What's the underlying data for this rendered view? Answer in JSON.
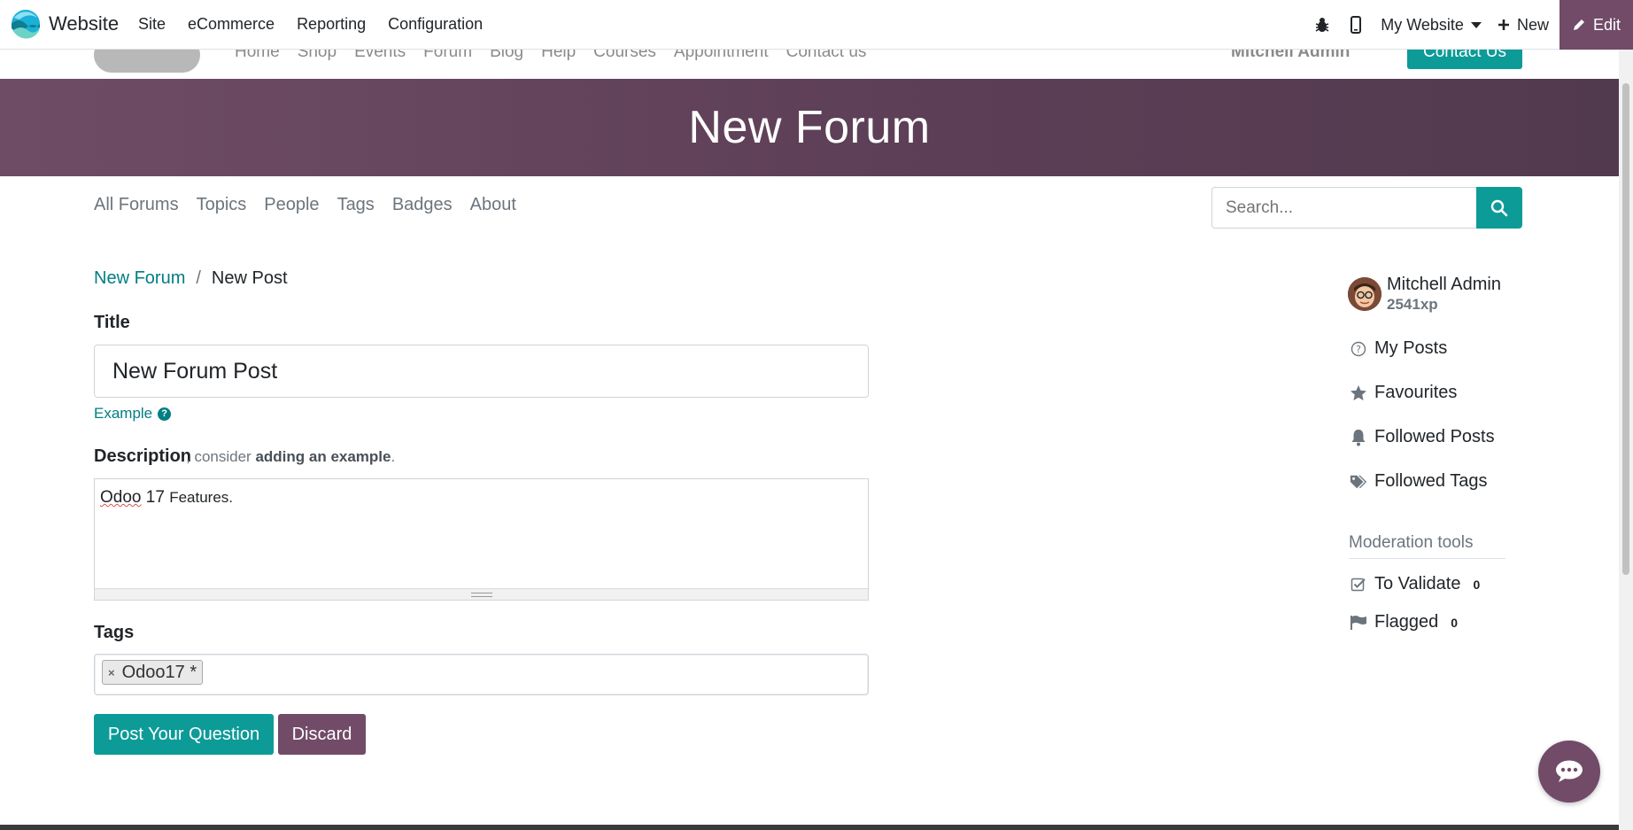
{
  "topbar": {
    "app_name": "Website",
    "menu": [
      "Site",
      "eCommerce",
      "Reporting",
      "Configuration"
    ],
    "website_selector": "My Website",
    "new_label": "New",
    "edit_label": "Edit"
  },
  "site_header": {
    "nav": [
      "Home",
      "Shop",
      "Events",
      "Forum",
      "Blog",
      "Help",
      "Courses",
      "Appointment",
      "Contact us"
    ],
    "user": "Mitchell Admin",
    "contact_button": "Contact Us"
  },
  "hero": {
    "title": "New Forum"
  },
  "forum_nav": [
    "All Forums",
    "Topics",
    "People",
    "Tags",
    "Badges",
    "About"
  ],
  "search": {
    "placeholder": "Search..."
  },
  "breadcrumb": {
    "parent": "New Forum",
    "separator": "/",
    "current": "New Post"
  },
  "form": {
    "title_label": "Title",
    "title_value": "New Forum Post",
    "example_link": "Example",
    "description_label": "Description",
    "description_hint_prefix": ", consider",
    "description_hint_bold": "adding an example",
    "description_hint_suffix": ".",
    "description_word1": "Odoo",
    "description_word2": "17",
    "description_rest": "Features.",
    "tags_label": "Tags",
    "tags": [
      "Odoo17 *"
    ],
    "post_button": "Post Your Question",
    "discard_button": "Discard"
  },
  "sidebar": {
    "user_name": "Mitchell Admin",
    "xp": "2541xp",
    "items": [
      {
        "label": "My Posts",
        "icon": "question-circle-icon"
      },
      {
        "label": "Favourites",
        "icon": "star-icon"
      },
      {
        "label": "Followed Posts",
        "icon": "bell-icon"
      },
      {
        "label": "Followed Tags",
        "icon": "tags-icon"
      }
    ],
    "moderation_title": "Moderation tools",
    "to_validate": {
      "label": "To Validate",
      "count": "0"
    },
    "flagged": {
      "label": "Flagged",
      "count": "0"
    }
  },
  "colors": {
    "primary_teal": "#0d9b98",
    "odoo_purple": "#714b67",
    "link": "#017e84"
  }
}
